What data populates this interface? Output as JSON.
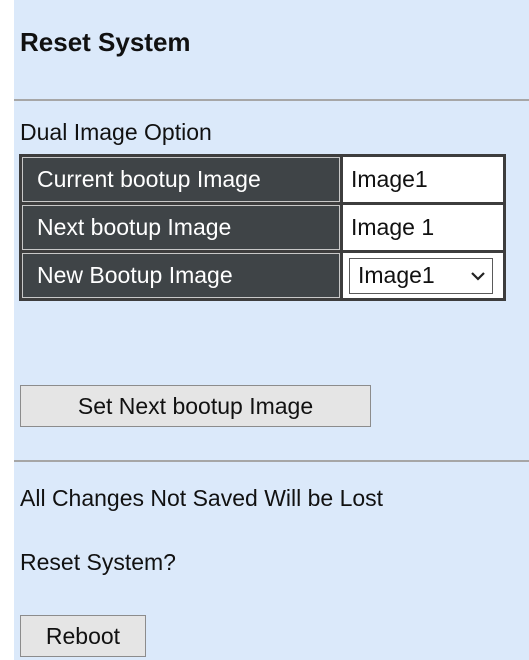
{
  "page": {
    "title": "Reset System"
  },
  "dual_image": {
    "section_label": "Dual Image Option",
    "rows": [
      {
        "label": "Current bootup Image",
        "value": "Image1"
      },
      {
        "label": "Next bootup Image",
        "value": "Image 1"
      },
      {
        "label": "New Bootup Image",
        "selected": "Image1"
      }
    ],
    "dropdown_icon": "chevron-down-icon",
    "set_button_label": "Set Next bootup Image"
  },
  "reset": {
    "warning": "All Changes Not Saved Will be Lost",
    "prompt": "Reset System?",
    "reboot_button_label": "Reboot"
  },
  "colors": {
    "background": "#dbe9fa",
    "label_cell": "#3f4447",
    "table_border": "#3d3d3d",
    "button": "#e5e5e5"
  }
}
